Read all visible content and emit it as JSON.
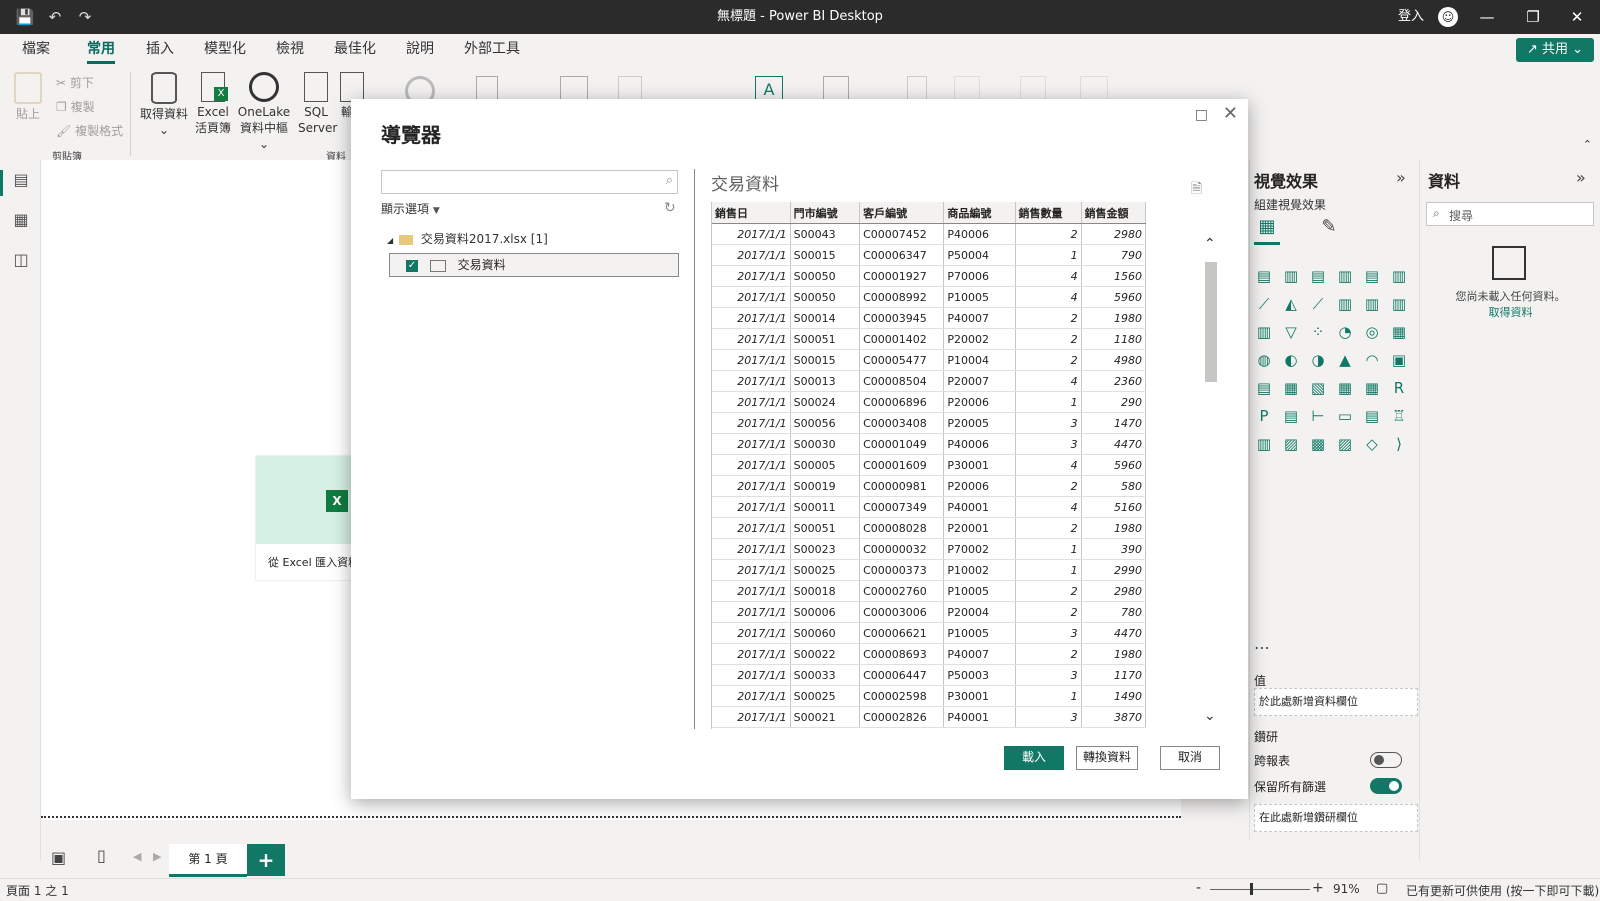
{
  "app": {
    "title": "無標題 - Power BI Desktop",
    "signin": "登入"
  },
  "tabs": [
    "檔案",
    "常用",
    "插入",
    "模型化",
    "檢視",
    "最佳化",
    "說明",
    "外部工具"
  ],
  "share_label": "共用",
  "ribbon": {
    "clipboard": {
      "paste": "貼上",
      "cut": "剪下",
      "copy": "複製",
      "format": "複製格式",
      "group": "剪貼簿"
    },
    "data": {
      "get_data": "取得資料",
      "excel": "Excel",
      "excel2": "活頁簿",
      "onelake": "OneLake",
      "onelake2": "資料中樞",
      "sql": "SQL",
      "sql2": "Server",
      "enter": "輸",
      "group": "資料"
    }
  },
  "canvas": {
    "excel_card": "從 Excel 匯入資料"
  },
  "dialog": {
    "title": "導覽器",
    "show_options": "顯示選項",
    "file": "交易資料2017.xlsx [1]",
    "sheet": "交易資料",
    "preview_title": "交易資料",
    "columns": [
      "銷售日",
      "門市編號",
      "客戶編號",
      "商品編號",
      "銷售數量",
      "銷售金額"
    ],
    "rows": [
      [
        "2017/1/1",
        "S00043",
        "C00007452",
        "P40006",
        "2",
        "2980"
      ],
      [
        "2017/1/1",
        "S00015",
        "C00006347",
        "P50004",
        "1",
        "790"
      ],
      [
        "2017/1/1",
        "S00050",
        "C00001927",
        "P70006",
        "4",
        "1560"
      ],
      [
        "2017/1/1",
        "S00050",
        "C00008992",
        "P10005",
        "4",
        "5960"
      ],
      [
        "2017/1/1",
        "S00014",
        "C00003945",
        "P40007",
        "2",
        "1980"
      ],
      [
        "2017/1/1",
        "S00051",
        "C00001402",
        "P20002",
        "2",
        "1180"
      ],
      [
        "2017/1/1",
        "S00015",
        "C00005477",
        "P10004",
        "2",
        "4980"
      ],
      [
        "2017/1/1",
        "S00013",
        "C00008504",
        "P20007",
        "4",
        "2360"
      ],
      [
        "2017/1/1",
        "S00024",
        "C00006896",
        "P20006",
        "1",
        "290"
      ],
      [
        "2017/1/1",
        "S00056",
        "C00003408",
        "P20005",
        "3",
        "1470"
      ],
      [
        "2017/1/1",
        "S00030",
        "C00001049",
        "P40006",
        "3",
        "4470"
      ],
      [
        "2017/1/1",
        "S00005",
        "C00001609",
        "P30001",
        "4",
        "5960"
      ],
      [
        "2017/1/1",
        "S00019",
        "C00000981",
        "P20006",
        "2",
        "580"
      ],
      [
        "2017/1/1",
        "S00011",
        "C00007349",
        "P40001",
        "4",
        "5160"
      ],
      [
        "2017/1/1",
        "S00051",
        "C00008028",
        "P20001",
        "2",
        "1980"
      ],
      [
        "2017/1/1",
        "S00023",
        "C00000032",
        "P70002",
        "1",
        "390"
      ],
      [
        "2017/1/1",
        "S00025",
        "C00000373",
        "P10002",
        "1",
        "2990"
      ],
      [
        "2017/1/1",
        "S00018",
        "C00002760",
        "P10005",
        "2",
        "2980"
      ],
      [
        "2017/1/1",
        "S00006",
        "C00003006",
        "P20004",
        "2",
        "780"
      ],
      [
        "2017/1/1",
        "S00060",
        "C00006621",
        "P10005",
        "3",
        "4470"
      ],
      [
        "2017/1/1",
        "S00022",
        "C00008693",
        "P40007",
        "2",
        "1980"
      ],
      [
        "2017/1/1",
        "S00033",
        "C00006447",
        "P50003",
        "3",
        "1170"
      ],
      [
        "2017/1/1",
        "S00025",
        "C00002598",
        "P30001",
        "1",
        "1490"
      ],
      [
        "2017/1/1",
        "S00021",
        "C00002826",
        "P40001",
        "3",
        "3870"
      ]
    ],
    "buttons": {
      "load": "載入",
      "transform": "轉換資料",
      "cancel": "取消"
    }
  },
  "visuals": {
    "title": "視覺效果",
    "subtitle": "組建視覺效果",
    "values_label": "值",
    "values_placeholder": "於此處新增資料欄位",
    "drill": "鑽研",
    "cross_report": "跨報表",
    "keep_filters": "保留所有篩選",
    "drill_placeholder": "在此處新增鑽研欄位"
  },
  "data_pane": {
    "title": "資料",
    "search_placeholder": "搜尋",
    "empty_text": "您尚未載入任何資料。",
    "get_data_link": "取得資料"
  },
  "pages": {
    "page1": "第 1 頁"
  },
  "status": {
    "page": "頁面 1 之 1",
    "zoom": "91%",
    "update": "已有更新可供使用 (按一下即可下載)"
  },
  "colors": {
    "accent": "#117865",
    "titlebar": "#2b2b2b"
  }
}
